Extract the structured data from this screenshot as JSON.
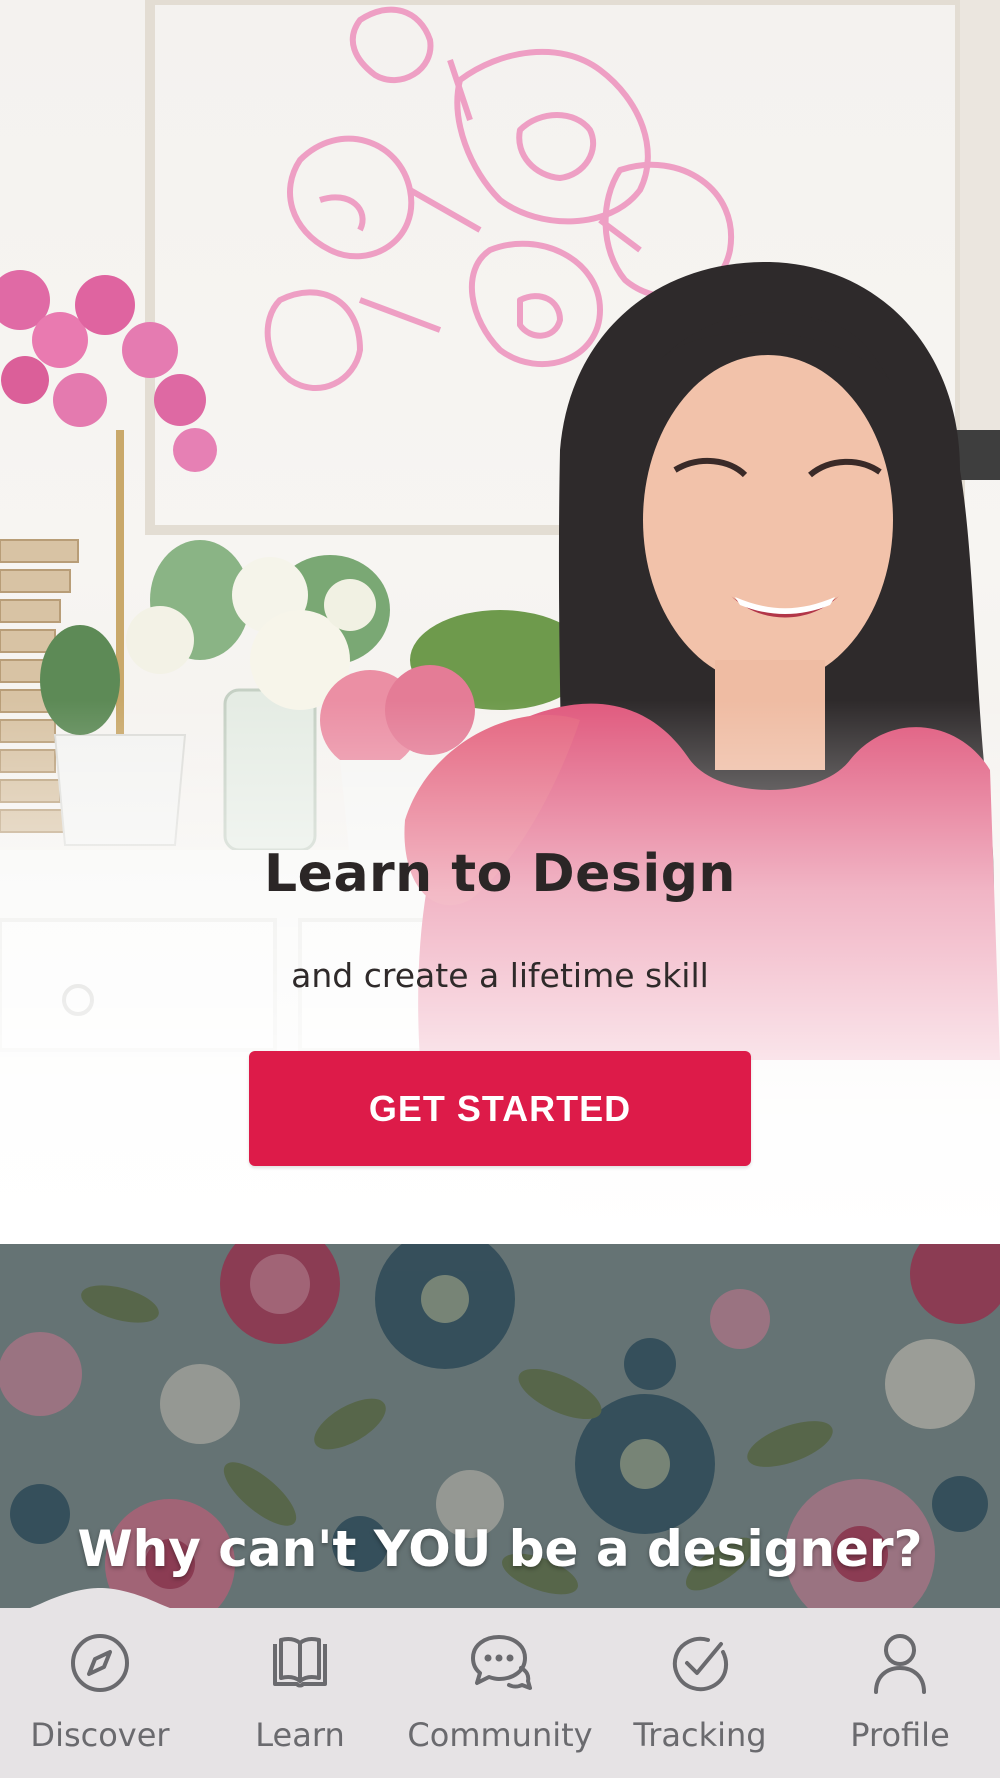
{
  "hero": {
    "title": "Learn to Design",
    "subtitle": "and create a lifetime skill",
    "cta_label": "GET STARTED",
    "cta_color": "#dd1b49"
  },
  "promo": {
    "title": "Why can't YOU be a designer?"
  },
  "bottom_nav": {
    "items": [
      {
        "label": "Discover",
        "icon": "compass-icon"
      },
      {
        "label": "Learn",
        "icon": "book-icon"
      },
      {
        "label": "Community",
        "icon": "chat-bubbles-icon"
      },
      {
        "label": "Tracking",
        "icon": "check-circle-icon"
      },
      {
        "label": "Profile",
        "icon": "user-icon"
      }
    ],
    "active_index": 0,
    "background": "#e6e3e5"
  }
}
